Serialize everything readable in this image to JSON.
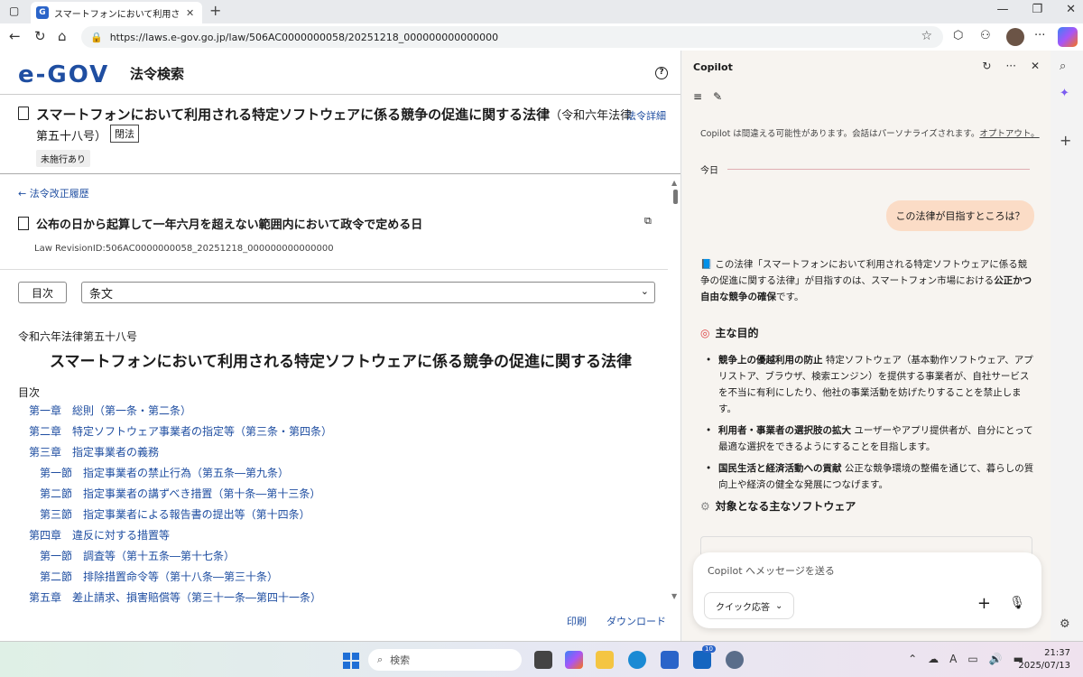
{
  "browser": {
    "tab_title": "スマートフォンにおいて利用される特定",
    "url": "https://laws.e-gov.go.jp/law/506AC0000000058/20251218_000000000000000"
  },
  "header": {
    "logo": "e-GOV",
    "subtitle": "法令検索"
  },
  "law": {
    "title": "スマートフォンにおいて利用される特定ソフトウェアに係る競争の促進に関する法律",
    "title_sub": "（令和六年法律",
    "title_line2": "第五十八号）",
    "closed_label": "閉法",
    "detail_link": "法令詳細",
    "badge": "未施行あり",
    "history_link": "法令改正履歴",
    "revision_title": "公布の日から起算して一年六月を超えない範囲内において政令で定める日",
    "revision_id": "Law RevisionID:506AC0000000058_20251218_000000000000000",
    "toc_button": "目次",
    "select_value": "条文",
    "law_number": "令和六年法律第五十八号",
    "body_title": "スマートフォンにおいて利用される特定ソフトウェアに係る競争の促進に関する法律",
    "toc_label": "目次",
    "toc": [
      {
        "level": 1,
        "text": "第一章　総則（第一条・第二条）"
      },
      {
        "level": 1,
        "text": "第二章　特定ソフトウェア事業者の指定等（第三条・第四条）"
      },
      {
        "level": 1,
        "text": "第三章　指定事業者の義務"
      },
      {
        "level": 2,
        "text": "第一節　指定事業者の禁止行為（第五条―第九条）"
      },
      {
        "level": 2,
        "text": "第二節　指定事業者の講ずべき措置（第十条―第十三条）"
      },
      {
        "level": 2,
        "text": "第三節　指定事業者による報告書の提出等（第十四条）"
      },
      {
        "level": 1,
        "text": "第四章　違反に対する措置等"
      },
      {
        "level": 2,
        "text": "第一節　調査等（第十五条―第十七条）"
      },
      {
        "level": 2,
        "text": "第二節　排除措置命令等（第十八条―第三十条）"
      },
      {
        "level": 1,
        "text": "第五章　差止請求、損害賠償等（第三十一条―第四十一条）"
      }
    ],
    "footer_print": "印刷",
    "footer_download": "ダウンロード"
  },
  "copilot": {
    "title": "Copilot",
    "disclaimer": "Copilot は間違える可能性があります。会話はパーソナライズされます。",
    "optout": "オプトアウト。",
    "today": "今日",
    "user_message": "この法律が目指すところは？",
    "answer_intro_1": "この法律「スマートフォンにおいて利用される特定ソフトウェアに係る競争の促進に関する法律」が目指すのは、スマートフォン市場における",
    "answer_intro_bold": "公正かつ自由な競争の確保",
    "answer_intro_2": "です。",
    "section1": "主な目的",
    "items": [
      {
        "bold": "競争上の優越利用の防止",
        "text": " 特定ソフトウェア（基本動作ソフトウェア、アプリストア、ブラウザ、検索エンジン）を提供する事業者が、自社サービスを不当に有利にしたり、他社の事業活動を妨げたりすることを禁止します。"
      },
      {
        "bold": "利用者・事業者の選択肢の拡大",
        "text": " ユーザーやアプリ提供者が、自分にとって最適な選択をできるようにすることを目指します。"
      },
      {
        "bold": "国民生活と経済活動への貢献",
        "text": " 公正な競争環境の整備を通じて、暮らしの質向上や経済の健全な発展につなげます。"
      }
    ],
    "section2": "対象となる主なソフトウェア",
    "composer_placeholder": "Copilot へメッセージを送る",
    "quick_reply": "クイック応答"
  },
  "taskbar": {
    "search": "検索",
    "time": "21:37",
    "date": "2025/07/13",
    "badge": "10"
  }
}
